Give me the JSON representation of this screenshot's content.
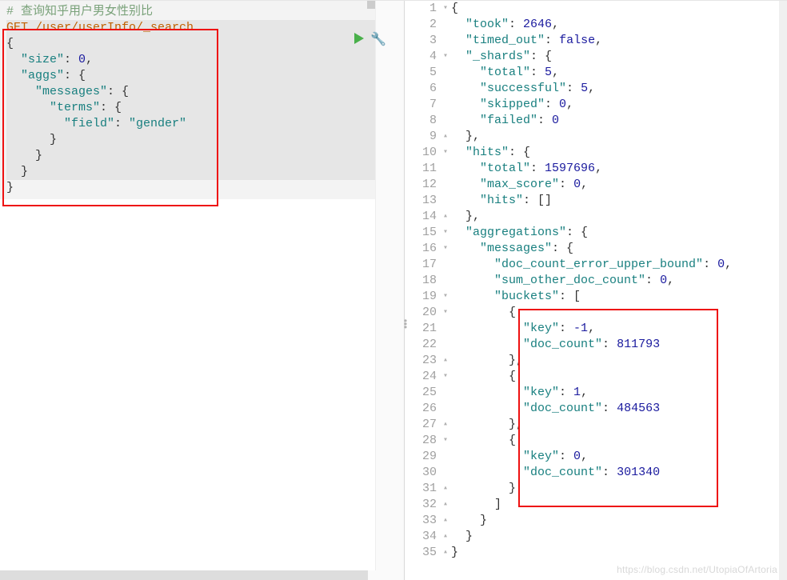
{
  "left": {
    "comment": "# 查询知乎用户男女性别比",
    "request_line": "GET /user/userInfo/_search",
    "code_lines": [
      "{",
      "  \"size\": 0,",
      "  \"aggs\": {",
      "    \"messages\": {",
      "      \"terms\": {",
      "        \"field\": \"gender\"",
      "      }",
      "    }",
      "  }",
      "}"
    ]
  },
  "right": {
    "lines": [
      {
        "n": 1,
        "f": "▾",
        "t": "{"
      },
      {
        "n": 2,
        "f": "",
        "t": "  \"took\": 2646,"
      },
      {
        "n": 3,
        "f": "",
        "t": "  \"timed_out\": false,"
      },
      {
        "n": 4,
        "f": "▾",
        "t": "  \"_shards\": {"
      },
      {
        "n": 5,
        "f": "",
        "t": "    \"total\": 5,"
      },
      {
        "n": 6,
        "f": "",
        "t": "    \"successful\": 5,"
      },
      {
        "n": 7,
        "f": "",
        "t": "    \"skipped\": 0,"
      },
      {
        "n": 8,
        "f": "",
        "t": "    \"failed\": 0"
      },
      {
        "n": 9,
        "f": "▴",
        "t": "  },"
      },
      {
        "n": 10,
        "f": "▾",
        "t": "  \"hits\": {"
      },
      {
        "n": 11,
        "f": "",
        "t": "    \"total\": 1597696,"
      },
      {
        "n": 12,
        "f": "",
        "t": "    \"max_score\": 0,"
      },
      {
        "n": 13,
        "f": "",
        "t": "    \"hits\": []"
      },
      {
        "n": 14,
        "f": "▴",
        "t": "  },"
      },
      {
        "n": 15,
        "f": "▾",
        "t": "  \"aggregations\": {"
      },
      {
        "n": 16,
        "f": "▾",
        "t": "    \"messages\": {"
      },
      {
        "n": 17,
        "f": "",
        "t": "      \"doc_count_error_upper_bound\": 0,"
      },
      {
        "n": 18,
        "f": "",
        "t": "      \"sum_other_doc_count\": 0,"
      },
      {
        "n": 19,
        "f": "▾",
        "t": "      \"buckets\": ["
      },
      {
        "n": 20,
        "f": "▾",
        "t": "        {"
      },
      {
        "n": 21,
        "f": "",
        "t": "          \"key\": -1,"
      },
      {
        "n": 22,
        "f": "",
        "t": "          \"doc_count\": 811793"
      },
      {
        "n": 23,
        "f": "▴",
        "t": "        },"
      },
      {
        "n": 24,
        "f": "▾",
        "t": "        {"
      },
      {
        "n": 25,
        "f": "",
        "t": "          \"key\": 1,"
      },
      {
        "n": 26,
        "f": "",
        "t": "          \"doc_count\": 484563"
      },
      {
        "n": 27,
        "f": "▴",
        "t": "        },"
      },
      {
        "n": 28,
        "f": "▾",
        "t": "        {"
      },
      {
        "n": 29,
        "f": "",
        "t": "          \"key\": 0,"
      },
      {
        "n": 30,
        "f": "",
        "t": "          \"doc_count\": 301340"
      },
      {
        "n": 31,
        "f": "▴",
        "t": "        }"
      },
      {
        "n": 32,
        "f": "▴",
        "t": "      ]"
      },
      {
        "n": 33,
        "f": "▴",
        "t": "    }"
      },
      {
        "n": 34,
        "f": "▴",
        "t": "  }"
      },
      {
        "n": 35,
        "f": "▴",
        "t": "}"
      }
    ]
  },
  "watermark": "https://blog.csdn.net/UtopiaOfArtoria"
}
